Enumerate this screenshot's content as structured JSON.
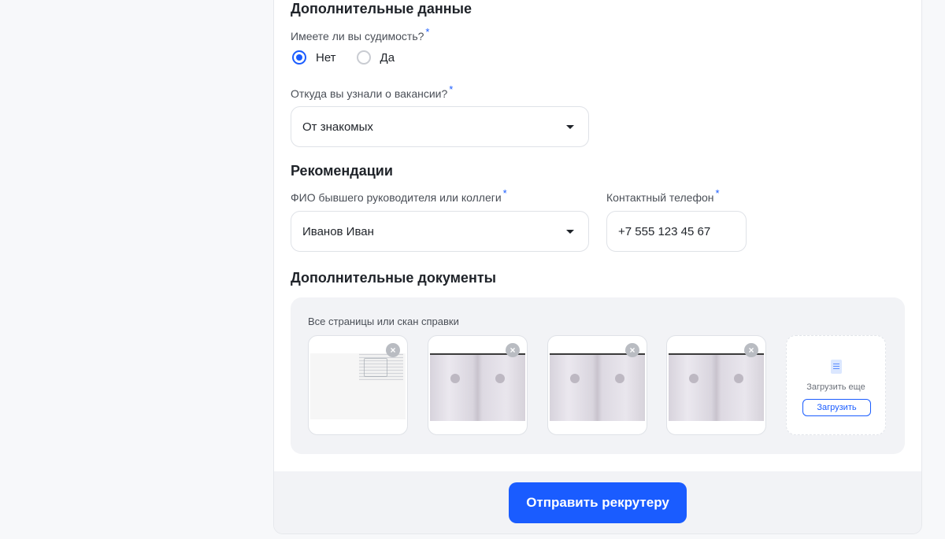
{
  "additional": {
    "title": "Дополнительные данные",
    "criminal_question": "Имеете ли вы судимость?",
    "required_mark": "*",
    "options": [
      {
        "label": "Нет",
        "checked": true
      },
      {
        "label": "Да",
        "checked": false
      }
    ],
    "source_question": "Откуда вы узнали о вакансии?",
    "source_value": "От знакомых"
  },
  "recommendations": {
    "title": "Рекомендации",
    "referee_label": "ФИО бывшего руководителя или коллеги",
    "referee_value": "Иванов Иван",
    "phone_label": "Контактный телефон",
    "phone_value": "+7 555 123 45 67"
  },
  "documents": {
    "title": "Дополнительные документы",
    "upload_label": "Все страницы или скан справки",
    "files": [
      "certificate-scan",
      "passport-scan",
      "passport-scan",
      "passport-scan"
    ],
    "upload_more_text": "Загрузить еще",
    "upload_button": "Загрузить"
  },
  "footer": {
    "submit_label": "Отправить рекрутеру"
  },
  "colors": {
    "accent": "#1a5cff",
    "background": "#f7f8fa",
    "panel": "#f2f3f6"
  }
}
